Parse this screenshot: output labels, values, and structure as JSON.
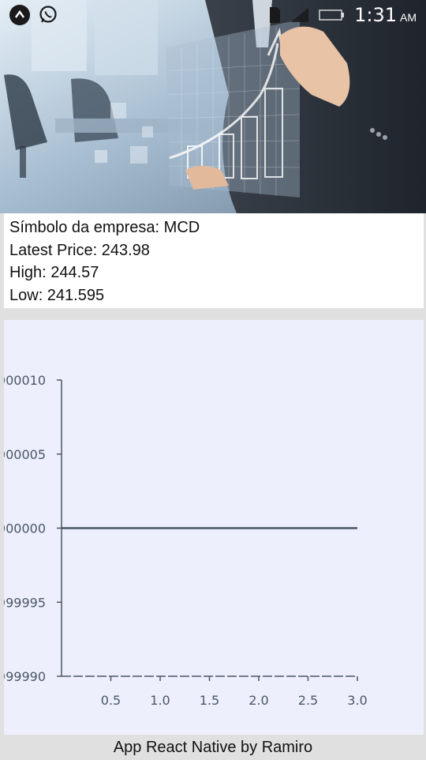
{
  "status_bar": {
    "time": "1:31",
    "ampm": "AM",
    "colors": {
      "icon_dark": "#1a1a1a",
      "icon_light": "#ffffff"
    }
  },
  "hero": {
    "image_description_icon": "business-chart-photo-icon"
  },
  "info": {
    "symbol": "Símbolo da empresa: MCD",
    "latest_price": "Latest Price: 243.98",
    "high": "High: 244.57",
    "low": "Low: 241.595"
  },
  "chart_data": {
    "type": "line",
    "x": [
      0,
      0.5,
      1.0,
      1.5,
      2.0,
      2.5,
      3.0
    ],
    "series": [
      {
        "values": [
          1,
          1,
          1,
          1,
          1,
          1,
          1
        ]
      }
    ],
    "x_tick_labels": [
      "0.5",
      "1.0",
      "1.5",
      "2.0",
      "2.5",
      "3.0"
    ],
    "y_tick_labels": [
      "000010",
      "000005",
      "000000",
      "999995",
      "999990"
    ],
    "xlim": [
      0,
      3
    ],
    "ylim": [
      0.99999,
      1.00001
    ],
    "grid": false,
    "line_color": "#4a5664",
    "background": "#eeeffd"
  },
  "footer": {
    "text": "App React Native by Ramiro"
  }
}
